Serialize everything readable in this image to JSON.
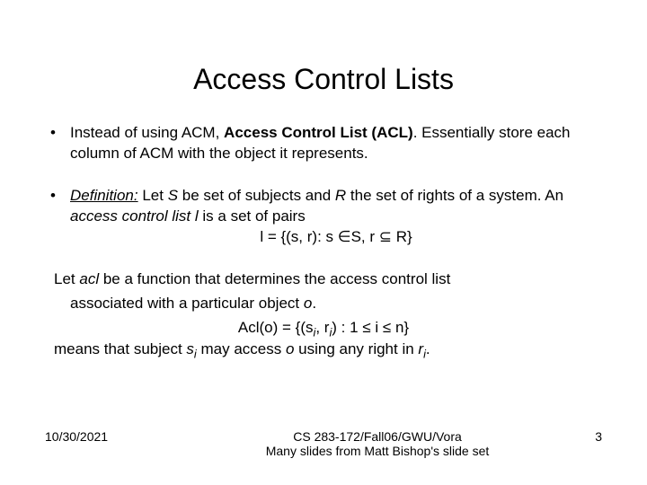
{
  "title": "Access Control Lists",
  "b1": {
    "pre": "Instead of using ACM, ",
    "strong": "Access Control List (ACL)",
    "post": ". Essentially store each column of ACM with the object it represents."
  },
  "b2": {
    "defn_label": "Definition:",
    "defn_s": "S",
    "defn_mid1": " be set of subjects and ",
    "defn_r": "R",
    "defn_mid2": " the set of rights of a system.  An ",
    "acl_ital": "access control list l",
    "defn_end": " is a set of pairs",
    "pre_let": " Let ",
    "eq1_lhs": "l = {(s, r): s ",
    "eq1_in": "∈",
    "eq1_mid": "S, r ",
    "eq1_sub": "⊆",
    "eq1_end": " R}"
  },
  "p3": {
    "l1a": "Let ",
    "l1_acl": "acl",
    "l1b": " be a function that determines the access control list",
    "l2": "associated with a particular object ",
    "l2_o": "o",
    "l2_dot": ".",
    "eq2_a": "Acl(o) = {(s",
    "eq2_b": ", r",
    "eq2_c": ") : 1 ",
    "eq2_le1": "≤",
    "eq2_d": "  i  ",
    "eq2_le2": "≤",
    "eq2_e": "  n}",
    "sub_i": "i",
    "l4a": "means  that subject ",
    "l4_s": "s",
    "l4b": " may access ",
    "l4_o": "o",
    "l4c": " using any right in ",
    "l4_r": "r",
    "l4_dot": "."
  },
  "footer": {
    "date": "10/30/2021",
    "line1": "CS 283-172/Fall06/GWU/Vora",
    "line2": "Many slides from Matt Bishop's slide set",
    "page": "3"
  }
}
